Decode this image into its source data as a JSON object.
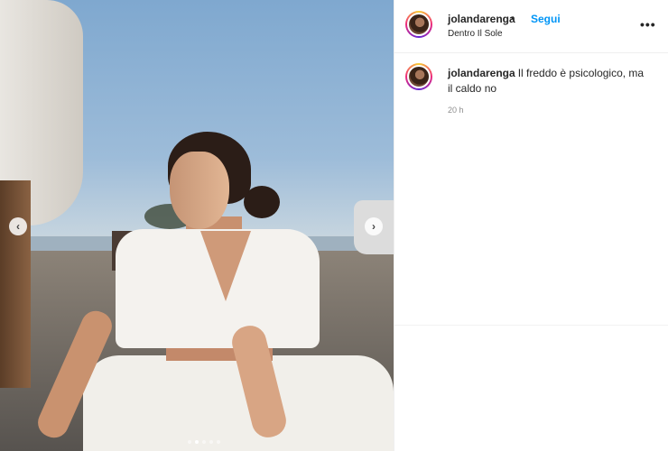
{
  "post": {
    "username": "jolandarenga",
    "separator": "•",
    "follow_label": "Segui",
    "location": "Dentro Il Sole",
    "more_label": "•••",
    "caption": {
      "username": "jolandarenga",
      "text": "Il freddo è psicologico, ma il caldo no"
    },
    "time_ago": "20 h"
  },
  "carousel": {
    "prev_label": "‹",
    "next_label": "›",
    "slide_count": 5,
    "active_slide": 2
  },
  "colors": {
    "accent": "#0095f6",
    "text": "#262626",
    "muted": "#8e8e8e"
  }
}
